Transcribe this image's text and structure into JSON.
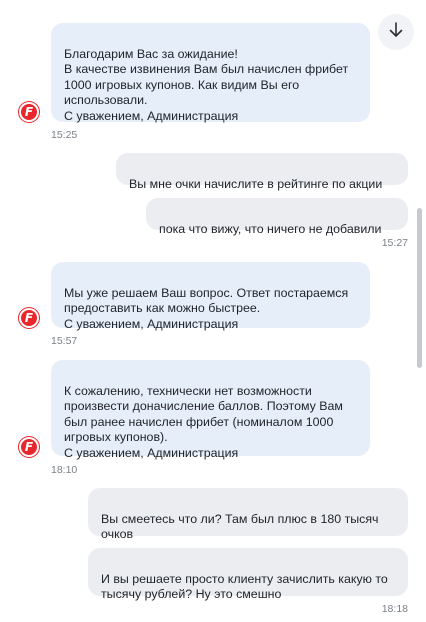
{
  "scroll_button": {
    "icon": "arrow-down-icon"
  },
  "messages": [
    {
      "sender": "support",
      "text": "Благодарим Вас за ожидание!\nВ качестве извинения Вам был начислен фрибет 1000 игровых купонов. Как видим Вы его использовали.\nС уважением, Администрация",
      "time": "15:25",
      "avatar_letter": "F"
    },
    {
      "sender": "user",
      "text": "Вы мне очки начислите в рейтинге по акции"
    },
    {
      "sender": "user",
      "text": "пока что вижу, что ничего не добавили",
      "time": "15:27"
    },
    {
      "sender": "support",
      "text": "Мы уже решаем Ваш вопрос. Ответ постараемся предоставить как можно быстрее.\nС уважением, Администрация",
      "time": "15:57",
      "avatar_letter": "F"
    },
    {
      "sender": "support",
      "text": "К сожалению, технически нет возможности произвести доначисление баллов. Поэтому Вам был ранее начислен фрибет (номиналом 1000 игровых купонов).\nС уважением, Администрация",
      "time": "18:10",
      "avatar_letter": "F"
    },
    {
      "sender": "user",
      "text": "Вы смеетесь что ли? Там был плюс в 180 тысяч очков"
    },
    {
      "sender": "user",
      "text": "И вы решаете просто клиенту зачислить какую то тысячу рублей? Ну это смешно",
      "time": "18:18"
    }
  ],
  "colors": {
    "support_bubble": "#e6eef9",
    "user_bubble": "#ebedf0",
    "brand": "#e8272c"
  }
}
